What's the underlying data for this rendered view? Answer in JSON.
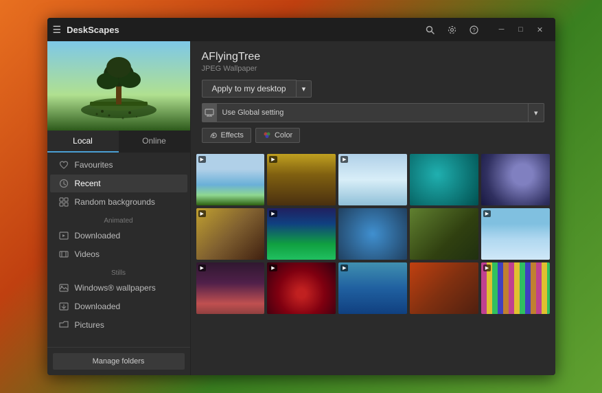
{
  "app": {
    "title": "DeskScapes"
  },
  "titlebar": {
    "minimize": "─",
    "maximize": "□",
    "close": "✕",
    "search_icon": "🔍",
    "settings_icon": "⚙",
    "help_icon": "?"
  },
  "wallpaper": {
    "name": "AFlyingTree",
    "type": "JPEG Wallpaper",
    "apply_btn": "Apply to my desktop",
    "global_setting": "Use Global setting",
    "effects_btn": "Effects",
    "color_btn": "Color"
  },
  "tabs": {
    "local": "Local",
    "online": "Online"
  },
  "sidebar": {
    "favourites": "Favourites",
    "recent": "Recent",
    "random_backgrounds": "Random backgrounds",
    "animated_label": "Animated",
    "downloaded_animated": "Downloaded",
    "videos": "Videos",
    "stills_label": "Stills",
    "windows_wallpapers": "Windows® wallpapers",
    "downloaded_stills": "Downloaded",
    "pictures": "Pictures",
    "manage_folders": "Manage folders"
  },
  "grid": {
    "items": [
      {
        "id": 1,
        "has_video": true
      },
      {
        "id": 2,
        "has_video": true
      },
      {
        "id": 3,
        "has_video": true
      },
      {
        "id": 4,
        "has_video": false
      },
      {
        "id": 5,
        "has_video": false
      },
      {
        "id": 6,
        "has_video": true
      },
      {
        "id": 7,
        "has_video": true
      },
      {
        "id": 8,
        "has_video": false
      },
      {
        "id": 9,
        "has_video": false
      },
      {
        "id": 10,
        "has_video": true
      },
      {
        "id": 11,
        "has_video": true
      },
      {
        "id": 12,
        "has_video": true
      },
      {
        "id": 13,
        "has_video": false
      },
      {
        "id": 14,
        "has_video": false
      },
      {
        "id": 15,
        "has_video": true
      }
    ]
  }
}
